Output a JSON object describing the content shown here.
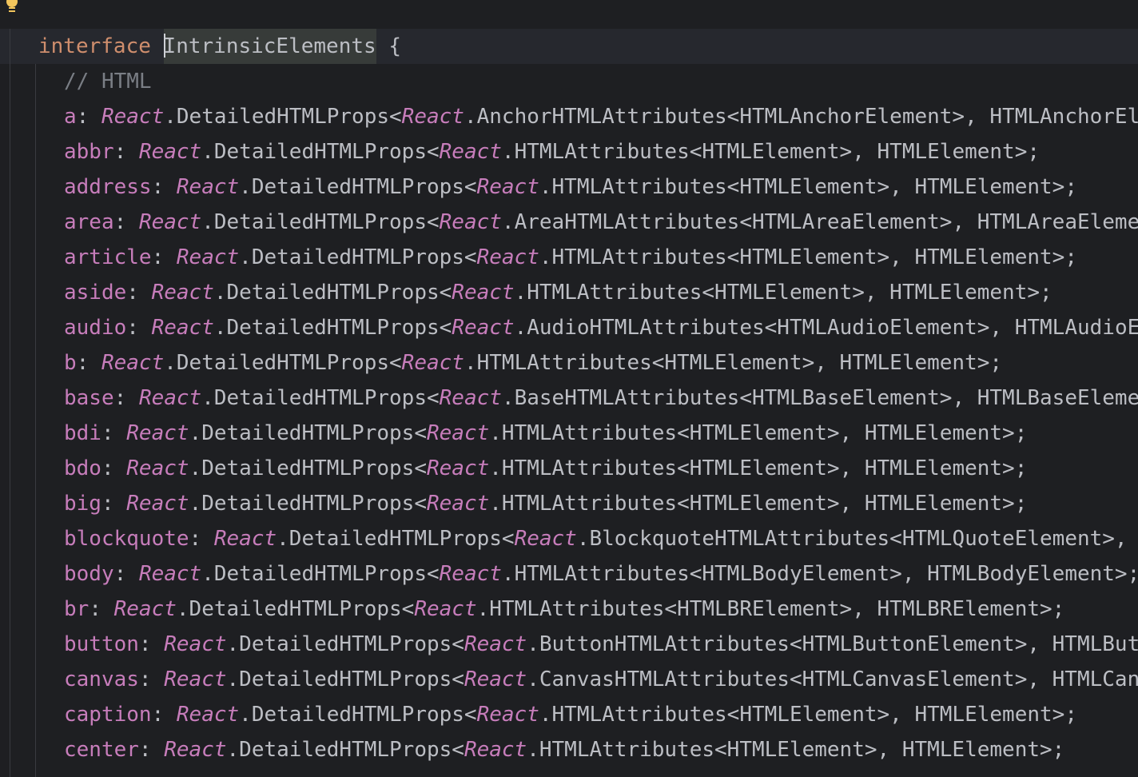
{
  "editor": {
    "header": {
      "keyword": "interface",
      "name": "IntrinsicElements",
      "brace": "{"
    },
    "comment": "// HTML",
    "ns": "React",
    "wrapper": "DetailedHTMLProps",
    "entries": [
      {
        "tag": "a",
        "attrs": "AnchorHTMLAttributes",
        "el": "HTMLAnchorElement"
      },
      {
        "tag": "abbr",
        "attrs": "HTMLAttributes",
        "el": "HTMLElement"
      },
      {
        "tag": "address",
        "attrs": "HTMLAttributes",
        "el": "HTMLElement"
      },
      {
        "tag": "area",
        "attrs": "AreaHTMLAttributes",
        "el": "HTMLAreaElement"
      },
      {
        "tag": "article",
        "attrs": "HTMLAttributes",
        "el": "HTMLElement"
      },
      {
        "tag": "aside",
        "attrs": "HTMLAttributes",
        "el": "HTMLElement"
      },
      {
        "tag": "audio",
        "attrs": "AudioHTMLAttributes",
        "el": "HTMLAudioElement"
      },
      {
        "tag": "b",
        "attrs": "HTMLAttributes",
        "el": "HTMLElement"
      },
      {
        "tag": "base",
        "attrs": "BaseHTMLAttributes",
        "el": "HTMLBaseElement"
      },
      {
        "tag": "bdi",
        "attrs": "HTMLAttributes",
        "el": "HTMLElement"
      },
      {
        "tag": "bdo",
        "attrs": "HTMLAttributes",
        "el": "HTMLElement"
      },
      {
        "tag": "big",
        "attrs": "HTMLAttributes",
        "el": "HTMLElement"
      },
      {
        "tag": "blockquote",
        "attrs": "BlockquoteHTMLAttributes",
        "el": "HTMLQuoteElement"
      },
      {
        "tag": "body",
        "attrs": "HTMLAttributes",
        "el": "HTMLBodyElement"
      },
      {
        "tag": "br",
        "attrs": "HTMLAttributes",
        "el": "HTMLBRElement"
      },
      {
        "tag": "button",
        "attrs": "ButtonHTMLAttributes",
        "el": "HTMLButtonElement"
      },
      {
        "tag": "canvas",
        "attrs": "CanvasHTMLAttributes",
        "el": "HTMLCanvasElement"
      },
      {
        "tag": "caption",
        "attrs": "HTMLAttributes",
        "el": "HTMLElement"
      },
      {
        "tag": "center",
        "attrs": "HTMLAttributes",
        "el": "HTMLElement"
      }
    ]
  }
}
